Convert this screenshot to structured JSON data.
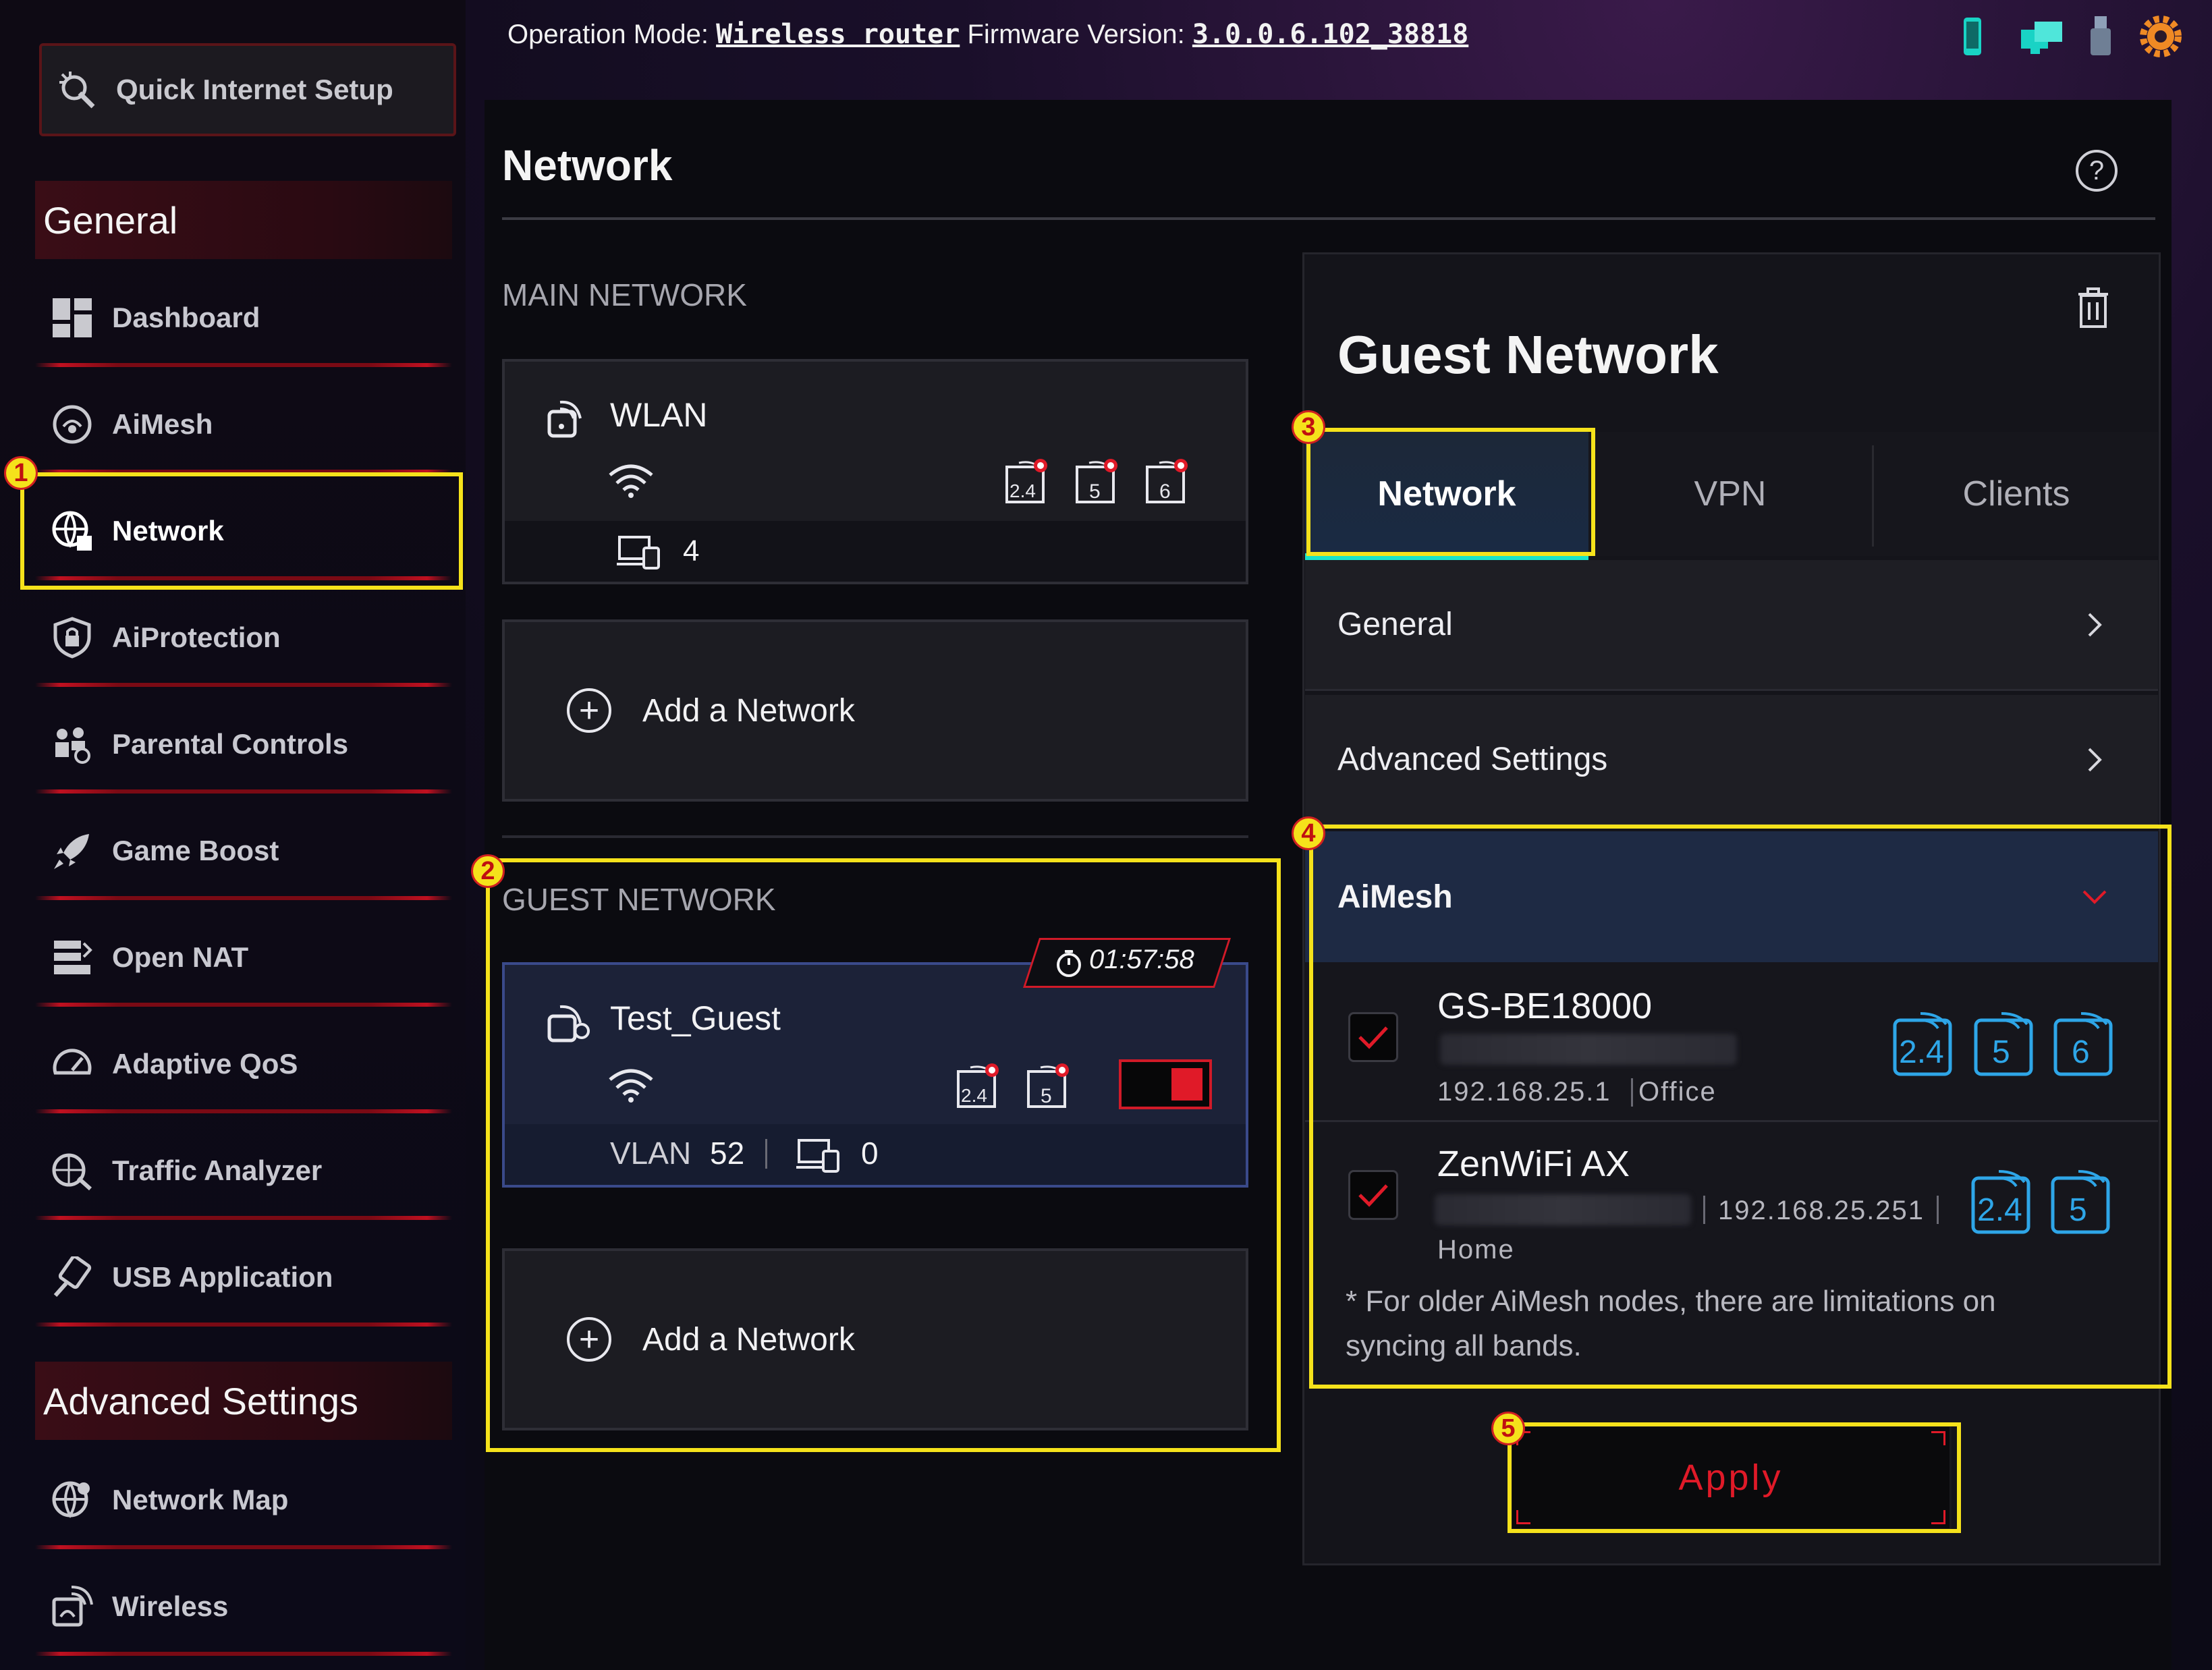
{
  "topbar": {
    "mode_label": "Operation Mode:",
    "mode_value": "Wireless router",
    "fw_label": "Firmware Version:",
    "fw_value": "3.0.0.6.102_38818",
    "icons": [
      "phone-icon",
      "network-icon",
      "usb-icon",
      "settings-gear-icon"
    ]
  },
  "sidebar": {
    "quick_setup": "Quick Internet Setup",
    "general_header": "General",
    "items": [
      {
        "label": "Dashboard",
        "icon": "dashboard-icon"
      },
      {
        "label": "AiMesh",
        "icon": "aimesh-icon"
      },
      {
        "label": "Network",
        "icon": "globe-network-icon",
        "active": true
      },
      {
        "label": "AiProtection",
        "icon": "shield-lock-icon"
      },
      {
        "label": "Parental Controls",
        "icon": "family-icon"
      },
      {
        "label": "Game Boost",
        "icon": "rocket-icon"
      },
      {
        "label": "Open NAT",
        "icon": "nat-icon"
      },
      {
        "label": "Adaptive QoS",
        "icon": "gauge-icon"
      },
      {
        "label": "Traffic Analyzer",
        "icon": "traffic-icon"
      },
      {
        "label": "USB Application",
        "icon": "usb-app-icon"
      }
    ],
    "advanced_header": "Advanced Settings",
    "advanced_items": [
      {
        "label": "Network Map",
        "icon": "globe-map-icon"
      },
      {
        "label": "Wireless",
        "icon": "wireless-icon"
      }
    ]
  },
  "page": {
    "title": "Network",
    "help": "?"
  },
  "main_network": {
    "section_label": "MAIN NETWORK",
    "card": {
      "name": "WLAN",
      "bands": [
        "2.4",
        "5",
        "6"
      ],
      "devices": "4"
    },
    "add_label": "Add a Network"
  },
  "guest_network": {
    "section_label": "GUEST NETWORK",
    "card": {
      "name": "Test_Guest",
      "timer": "01:57:58",
      "bands": [
        "2.4",
        "5"
      ],
      "vlan_label": "VLAN",
      "vlan_value": "52",
      "devices": "0",
      "enabled": true
    },
    "add_label": "Add a Network"
  },
  "panel": {
    "title": "Guest Network",
    "tabs": [
      {
        "label": "Network",
        "active": true
      },
      {
        "label": "VPN"
      },
      {
        "label": "Clients"
      }
    ],
    "accordions": [
      "General",
      "Advanced Settings"
    ],
    "aimesh": {
      "header": "AiMesh",
      "nodes": [
        {
          "name": "GS-BE18000",
          "ip": "192.168.25.1",
          "location": "Office",
          "bands": [
            "2.4",
            "5",
            "6"
          ],
          "checked": true
        },
        {
          "name": "ZenWiFi AX",
          "ip": "192.168.25.251",
          "location": "Home",
          "bands": [
            "2.4",
            "5"
          ],
          "checked": true
        }
      ],
      "note": "* For older AiMesh nodes, there are limitations on syncing all bands."
    },
    "apply": "Apply"
  },
  "annotations": [
    "1",
    "2",
    "3",
    "4",
    "5"
  ],
  "colors": {
    "accent_red": "#e01a28",
    "annotation_yellow": "#f5e21b",
    "tab_underline": "#19e3c9"
  }
}
